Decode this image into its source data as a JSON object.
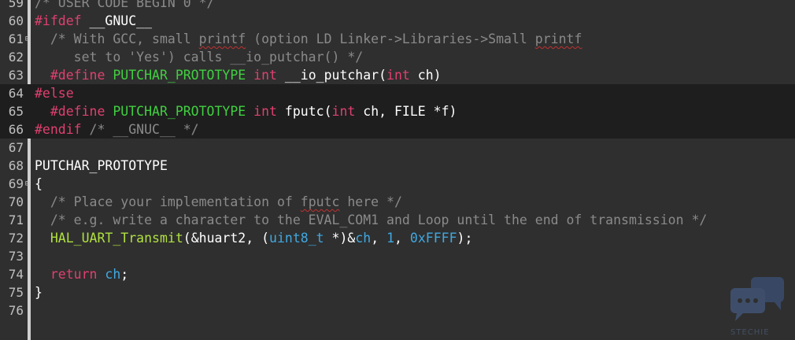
{
  "editor": {
    "lines": [
      {
        "num": "59",
        "tokens": [
          {
            "t": "/* USER CODE BEGIN 0 */",
            "c": "comment"
          }
        ]
      },
      {
        "num": "60",
        "tokens": [
          {
            "t": "#ifdef ",
            "c": "macro"
          },
          {
            "t": "__GNUC__",
            "c": "plain"
          }
        ]
      },
      {
        "num": "61",
        "tokens": [
          {
            "t": "  /* With GCC, small ",
            "c": "comment"
          },
          {
            "t": "printf",
            "c": "comment",
            "sq": true
          },
          {
            "t": " (option LD Linker->Libraries->Small ",
            "c": "comment"
          },
          {
            "t": "printf",
            "c": "comment",
            "sq": true
          }
        ]
      },
      {
        "num": "62",
        "tokens": [
          {
            "t": "     set to 'Yes') calls __io_putchar() */",
            "c": "comment"
          }
        ]
      },
      {
        "num": "63",
        "tokens": [
          {
            "t": "  #define ",
            "c": "macro"
          },
          {
            "t": "PUTCHAR_PROTOTYPE ",
            "c": "def"
          },
          {
            "t": "int ",
            "c": "kw"
          },
          {
            "t": "__io_putchar(",
            "c": "plain"
          },
          {
            "t": "int ",
            "c": "kw"
          },
          {
            "t": "ch)",
            "c": "plain"
          }
        ]
      },
      {
        "num": "64",
        "tokens": [
          {
            "t": "#else",
            "c": "macro"
          }
        ]
      },
      {
        "num": "65",
        "tokens": [
          {
            "t": "  #define ",
            "c": "macro"
          },
          {
            "t": "PUTCHAR_PROTOTYPE ",
            "c": "def"
          },
          {
            "t": "int ",
            "c": "kw"
          },
          {
            "t": "fputc(",
            "c": "plain"
          },
          {
            "t": "int ",
            "c": "kw"
          },
          {
            "t": "ch, FILE *f)",
            "c": "plain"
          }
        ]
      },
      {
        "num": "66",
        "tokens": [
          {
            "t": "#endif ",
            "c": "macro"
          },
          {
            "t": "/* __GNUC__ */",
            "c": "comment"
          }
        ]
      },
      {
        "num": "67",
        "tokens": []
      },
      {
        "num": "68",
        "tokens": [
          {
            "t": "PUTCHAR_PROTOTYPE",
            "c": "plain"
          }
        ]
      },
      {
        "num": "69",
        "tokens": [
          {
            "t": "{",
            "c": "plain"
          }
        ]
      },
      {
        "num": "70",
        "tokens": [
          {
            "t": "  /* Place your implementation of ",
            "c": "comment"
          },
          {
            "t": "fputc",
            "c": "comment",
            "sq": true
          },
          {
            "t": " here */",
            "c": "comment"
          }
        ]
      },
      {
        "num": "71",
        "tokens": [
          {
            "t": "  /* e.g. write a character to the EVAL_COM1 and Loop until the end of transmission */",
            "c": "comment"
          }
        ]
      },
      {
        "num": "72",
        "tokens": [
          {
            "t": "  ",
            "c": "plain"
          },
          {
            "t": "HAL_UART_Transmit",
            "c": "fn"
          },
          {
            "t": "(&huart2, (",
            "c": "plain"
          },
          {
            "t": "uint8_t",
            "c": "type"
          },
          {
            "t": " *)&",
            "c": "plain"
          },
          {
            "t": "ch",
            "c": "type"
          },
          {
            "t": ", ",
            "c": "plain"
          },
          {
            "t": "1",
            "c": "num"
          },
          {
            "t": ", ",
            "c": "plain"
          },
          {
            "t": "0xFFFF",
            "c": "num"
          },
          {
            "t": ");",
            "c": "plain"
          }
        ]
      },
      {
        "num": "73",
        "tokens": []
      },
      {
        "num": "74",
        "tokens": [
          {
            "t": "  ",
            "c": "plain"
          },
          {
            "t": "return ",
            "c": "kw"
          },
          {
            "t": "ch",
            "c": "type"
          },
          {
            "t": ";",
            "c": "plain"
          }
        ]
      },
      {
        "num": "75",
        "tokens": [
          {
            "t": "}",
            "c": "plain"
          }
        ]
      },
      {
        "num": "76",
        "tokens": []
      }
    ]
  },
  "watermark": {
    "text": "STECHIE",
    "icon": "chat-bubbles-icon"
  }
}
